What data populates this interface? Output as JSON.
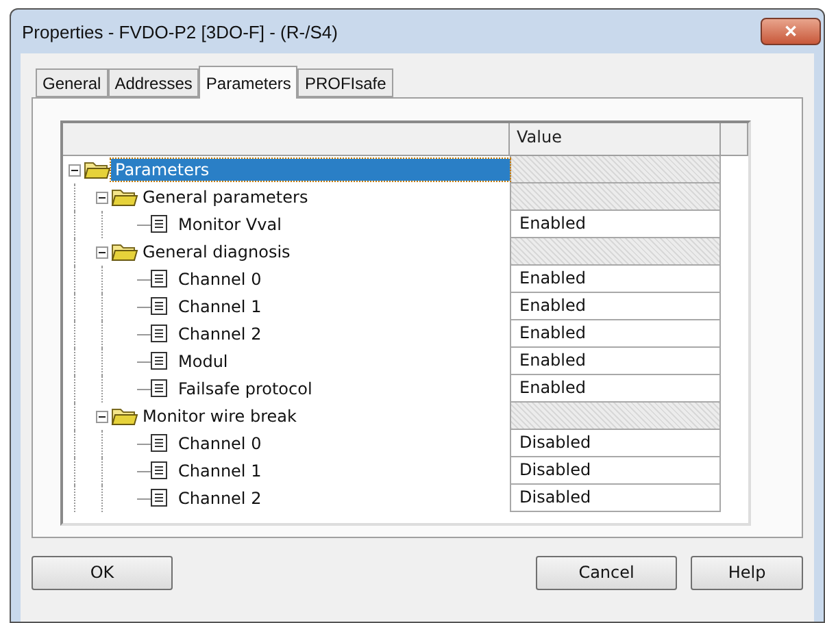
{
  "window": {
    "title": "Properties - FVDO-P2 [3DO-F] - (R-/S4)",
    "close": "✕"
  },
  "tabs": [
    {
      "label": "General",
      "selected": false
    },
    {
      "label": "Addresses",
      "selected": false
    },
    {
      "label": "Parameters",
      "selected": true
    },
    {
      "label": "PROFIsafe",
      "selected": false
    }
  ],
  "table": {
    "columns": [
      "Value"
    ],
    "tree": [
      {
        "kind": "folder",
        "label": "Parameters",
        "expanded": true,
        "selected": true,
        "children": [
          {
            "kind": "folder",
            "label": "General parameters",
            "expanded": true,
            "selected": false,
            "children": [
              {
                "kind": "item",
                "label": "Monitor Vval",
                "value": "Enabled",
                "selected": false
              }
            ]
          },
          {
            "kind": "folder",
            "label": "General diagnosis",
            "expanded": true,
            "selected": false,
            "children": [
              {
                "kind": "item",
                "label": "Channel 0",
                "value": "Enabled",
                "selected": false
              },
              {
                "kind": "item",
                "label": "Channel 1",
                "value": "Enabled",
                "selected": false
              },
              {
                "kind": "item",
                "label": "Channel 2",
                "value": "Enabled",
                "selected": false
              },
              {
                "kind": "item",
                "label": "Modul",
                "value": "Enabled",
                "selected": false
              },
              {
                "kind": "item",
                "label": "Failsafe protocol",
                "value": "Enabled",
                "selected": false
              }
            ]
          },
          {
            "kind": "folder",
            "label": "Monitor wire break",
            "expanded": true,
            "selected": false,
            "children": [
              {
                "kind": "item",
                "label": "Channel 0",
                "value": "Disabled",
                "selected": false
              },
              {
                "kind": "item",
                "label": "Channel 1",
                "value": "Disabled",
                "selected": false
              },
              {
                "kind": "item",
                "label": "Channel 2",
                "value": "Disabled",
                "selected": false
              }
            ]
          }
        ]
      }
    ]
  },
  "buttons": [
    {
      "label": "OK",
      "kind": "left"
    },
    {
      "label": "Cancel",
      "kind": "right"
    },
    {
      "label": "Help",
      "kind": "right"
    }
  ]
}
